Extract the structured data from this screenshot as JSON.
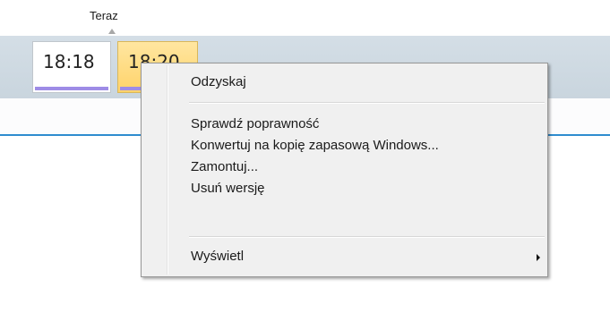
{
  "timeline": {
    "now_label": "Teraz",
    "snapshots": [
      {
        "time": "18:18",
        "selected": false
      },
      {
        "time": "18:20",
        "selected": true
      }
    ]
  },
  "context_menu": {
    "items": [
      {
        "label": "Odzyskaj"
      },
      {
        "label": "Sprawdź poprawność"
      },
      {
        "label": "Konwertuj na kopię zapasową Windows..."
      },
      {
        "label": "Zamontuj..."
      },
      {
        "label": "Usuń wersję"
      },
      {
        "label": "Wyświetl",
        "has_submenu": true,
        "submenu_icon": "chevron-right-icon"
      }
    ]
  },
  "colors": {
    "timeline_band": "#c9d5de",
    "timeline_line": "#2e8ccf",
    "selected_snapshot": "#ffd36a",
    "snapshot_bar": "#9e8ce6",
    "menu_background": "#f0f0f0"
  }
}
